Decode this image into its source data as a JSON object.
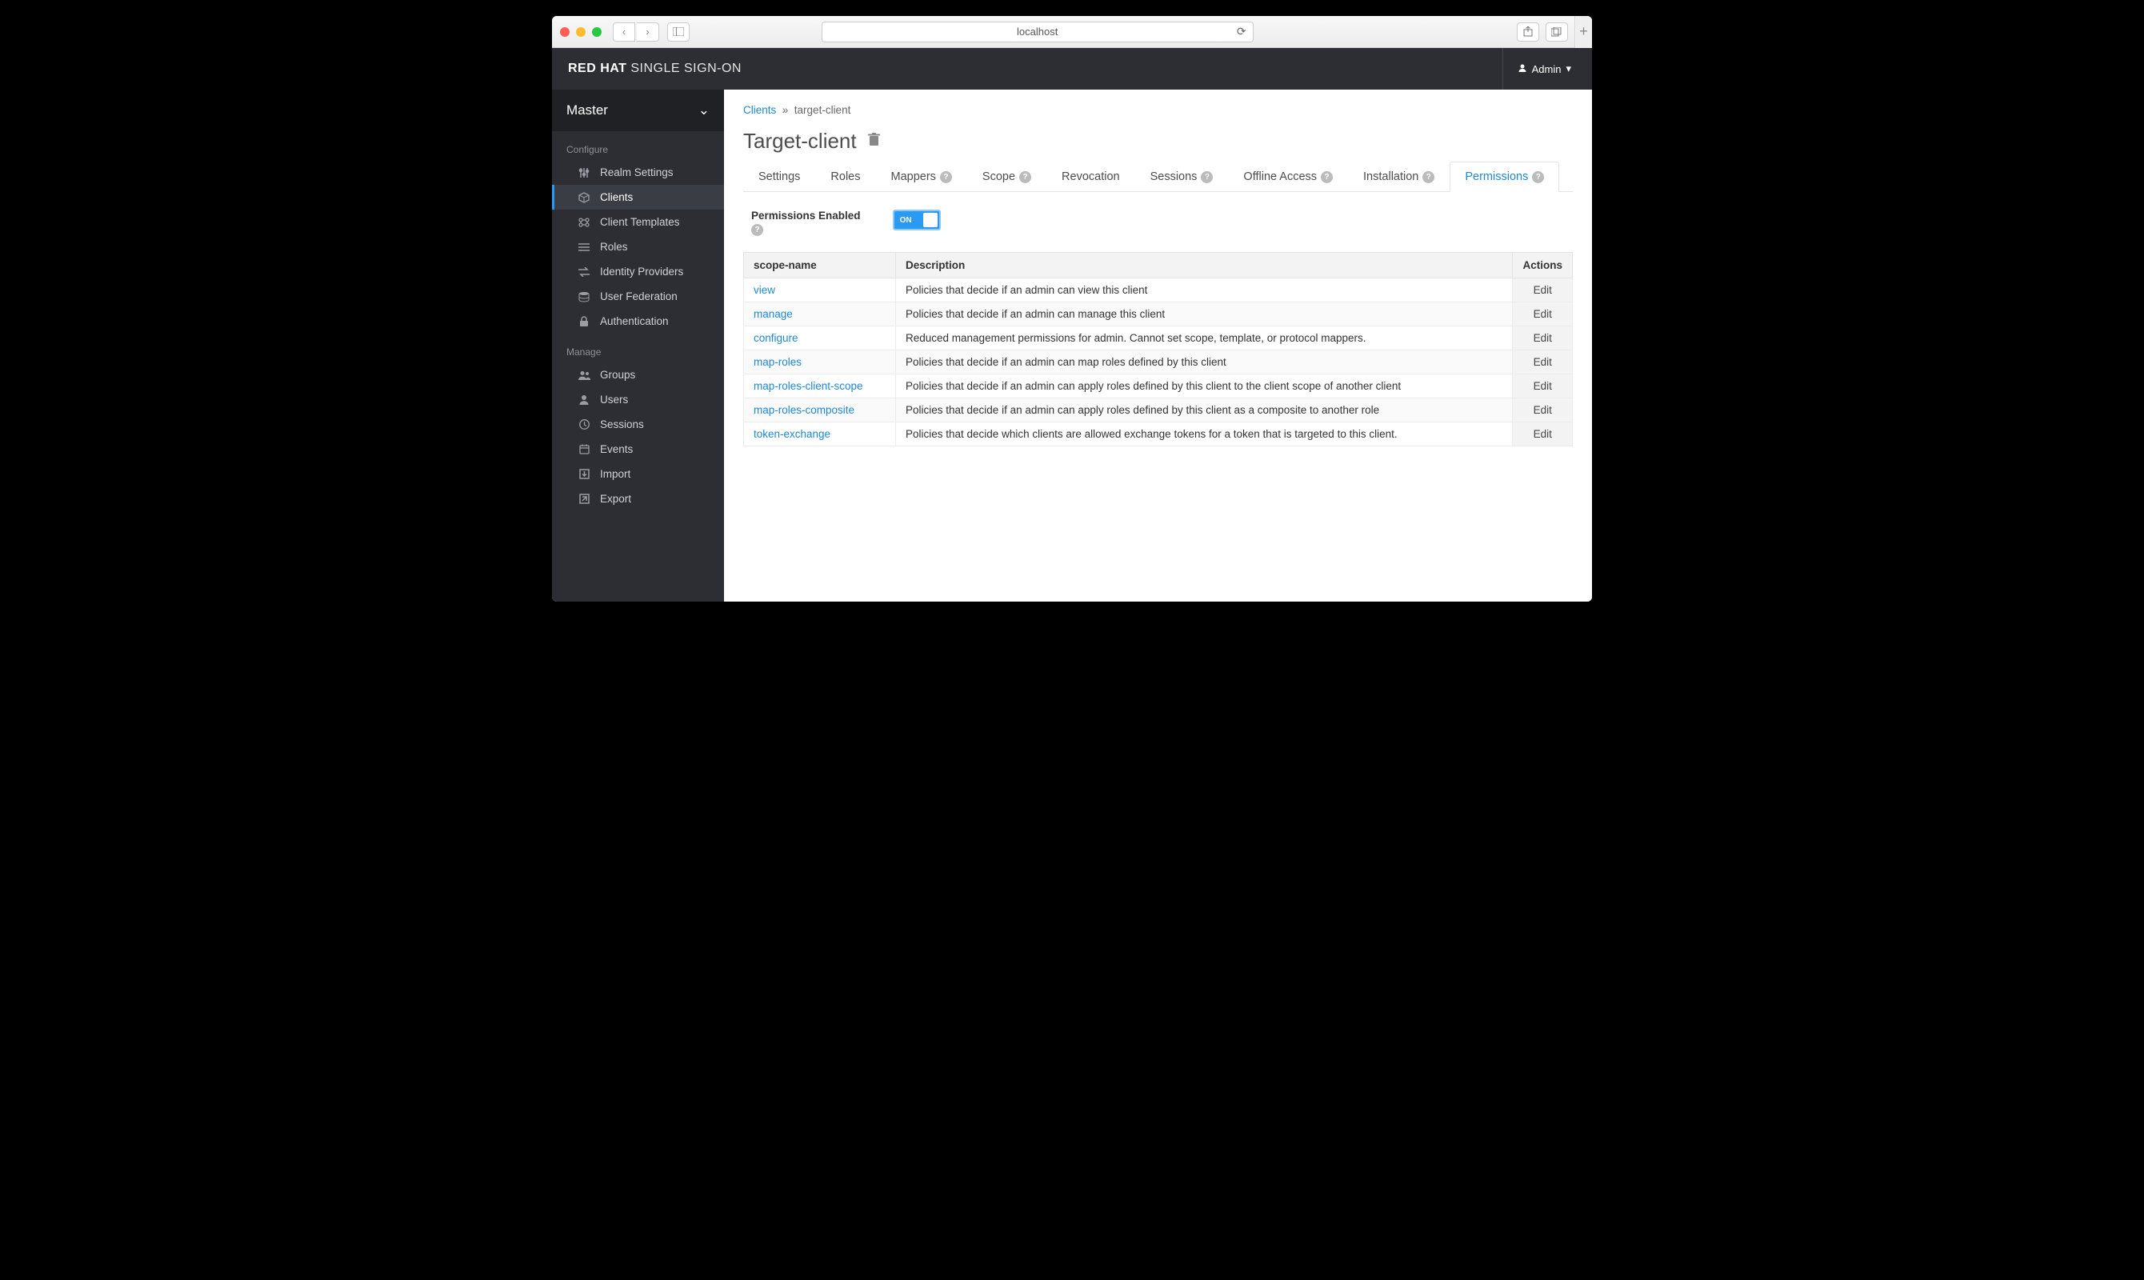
{
  "browser": {
    "url": "localhost"
  },
  "header": {
    "brand_bold": "RED HAT",
    "brand_light": "SINGLE SIGN-ON",
    "user": "Admin"
  },
  "sidebar": {
    "realm": "Master",
    "sections": {
      "configure_label": "Configure",
      "manage_label": "Manage"
    },
    "configure": [
      {
        "label": "Realm Settings",
        "icon": "sliders"
      },
      {
        "label": "Clients",
        "icon": "cube",
        "active": true
      },
      {
        "label": "Client Templates",
        "icon": "templates"
      },
      {
        "label": "Roles",
        "icon": "list"
      },
      {
        "label": "Identity Providers",
        "icon": "exchange"
      },
      {
        "label": "User Federation",
        "icon": "stack"
      },
      {
        "label": "Authentication",
        "icon": "lock"
      }
    ],
    "manage": [
      {
        "label": "Groups",
        "icon": "group"
      },
      {
        "label": "Users",
        "icon": "user"
      },
      {
        "label": "Sessions",
        "icon": "clock"
      },
      {
        "label": "Events",
        "icon": "calendar"
      },
      {
        "label": "Import",
        "icon": "import"
      },
      {
        "label": "Export",
        "icon": "export"
      }
    ]
  },
  "breadcrumb": {
    "root": "Clients",
    "current": "target-client"
  },
  "page_title": "Target-client",
  "tabs": [
    {
      "label": "Settings"
    },
    {
      "label": "Roles"
    },
    {
      "label": "Mappers",
      "help": true
    },
    {
      "label": "Scope",
      "help": true
    },
    {
      "label": "Revocation"
    },
    {
      "label": "Sessions",
      "help": true
    },
    {
      "label": "Offline Access",
      "help": true
    },
    {
      "label": "Installation",
      "help": true
    },
    {
      "label": "Permissions",
      "help": true,
      "active": true
    }
  ],
  "permissions": {
    "label": "Permissions Enabled",
    "toggle_text": "ON",
    "enabled": true
  },
  "table": {
    "headers": {
      "scope": "scope-name",
      "desc": "Description",
      "actions": "Actions"
    },
    "action_label": "Edit",
    "rows": [
      {
        "scope": "view",
        "desc": "Policies that decide if an admin can view this client"
      },
      {
        "scope": "manage",
        "desc": "Policies that decide if an admin can manage this client"
      },
      {
        "scope": "configure",
        "desc": "Reduced management permissions for admin. Cannot set scope, template, or protocol mappers."
      },
      {
        "scope": "map-roles",
        "desc": "Policies that decide if an admin can map roles defined by this client"
      },
      {
        "scope": "map-roles-client-scope",
        "desc": "Policies that decide if an admin can apply roles defined by this client to the client scope of another client"
      },
      {
        "scope": "map-roles-composite",
        "desc": "Policies that decide if an admin can apply roles defined by this client as a composite to another role"
      },
      {
        "scope": "token-exchange",
        "desc": "Policies that decide which clients are allowed exchange tokens for a token that is targeted to this client."
      }
    ]
  }
}
